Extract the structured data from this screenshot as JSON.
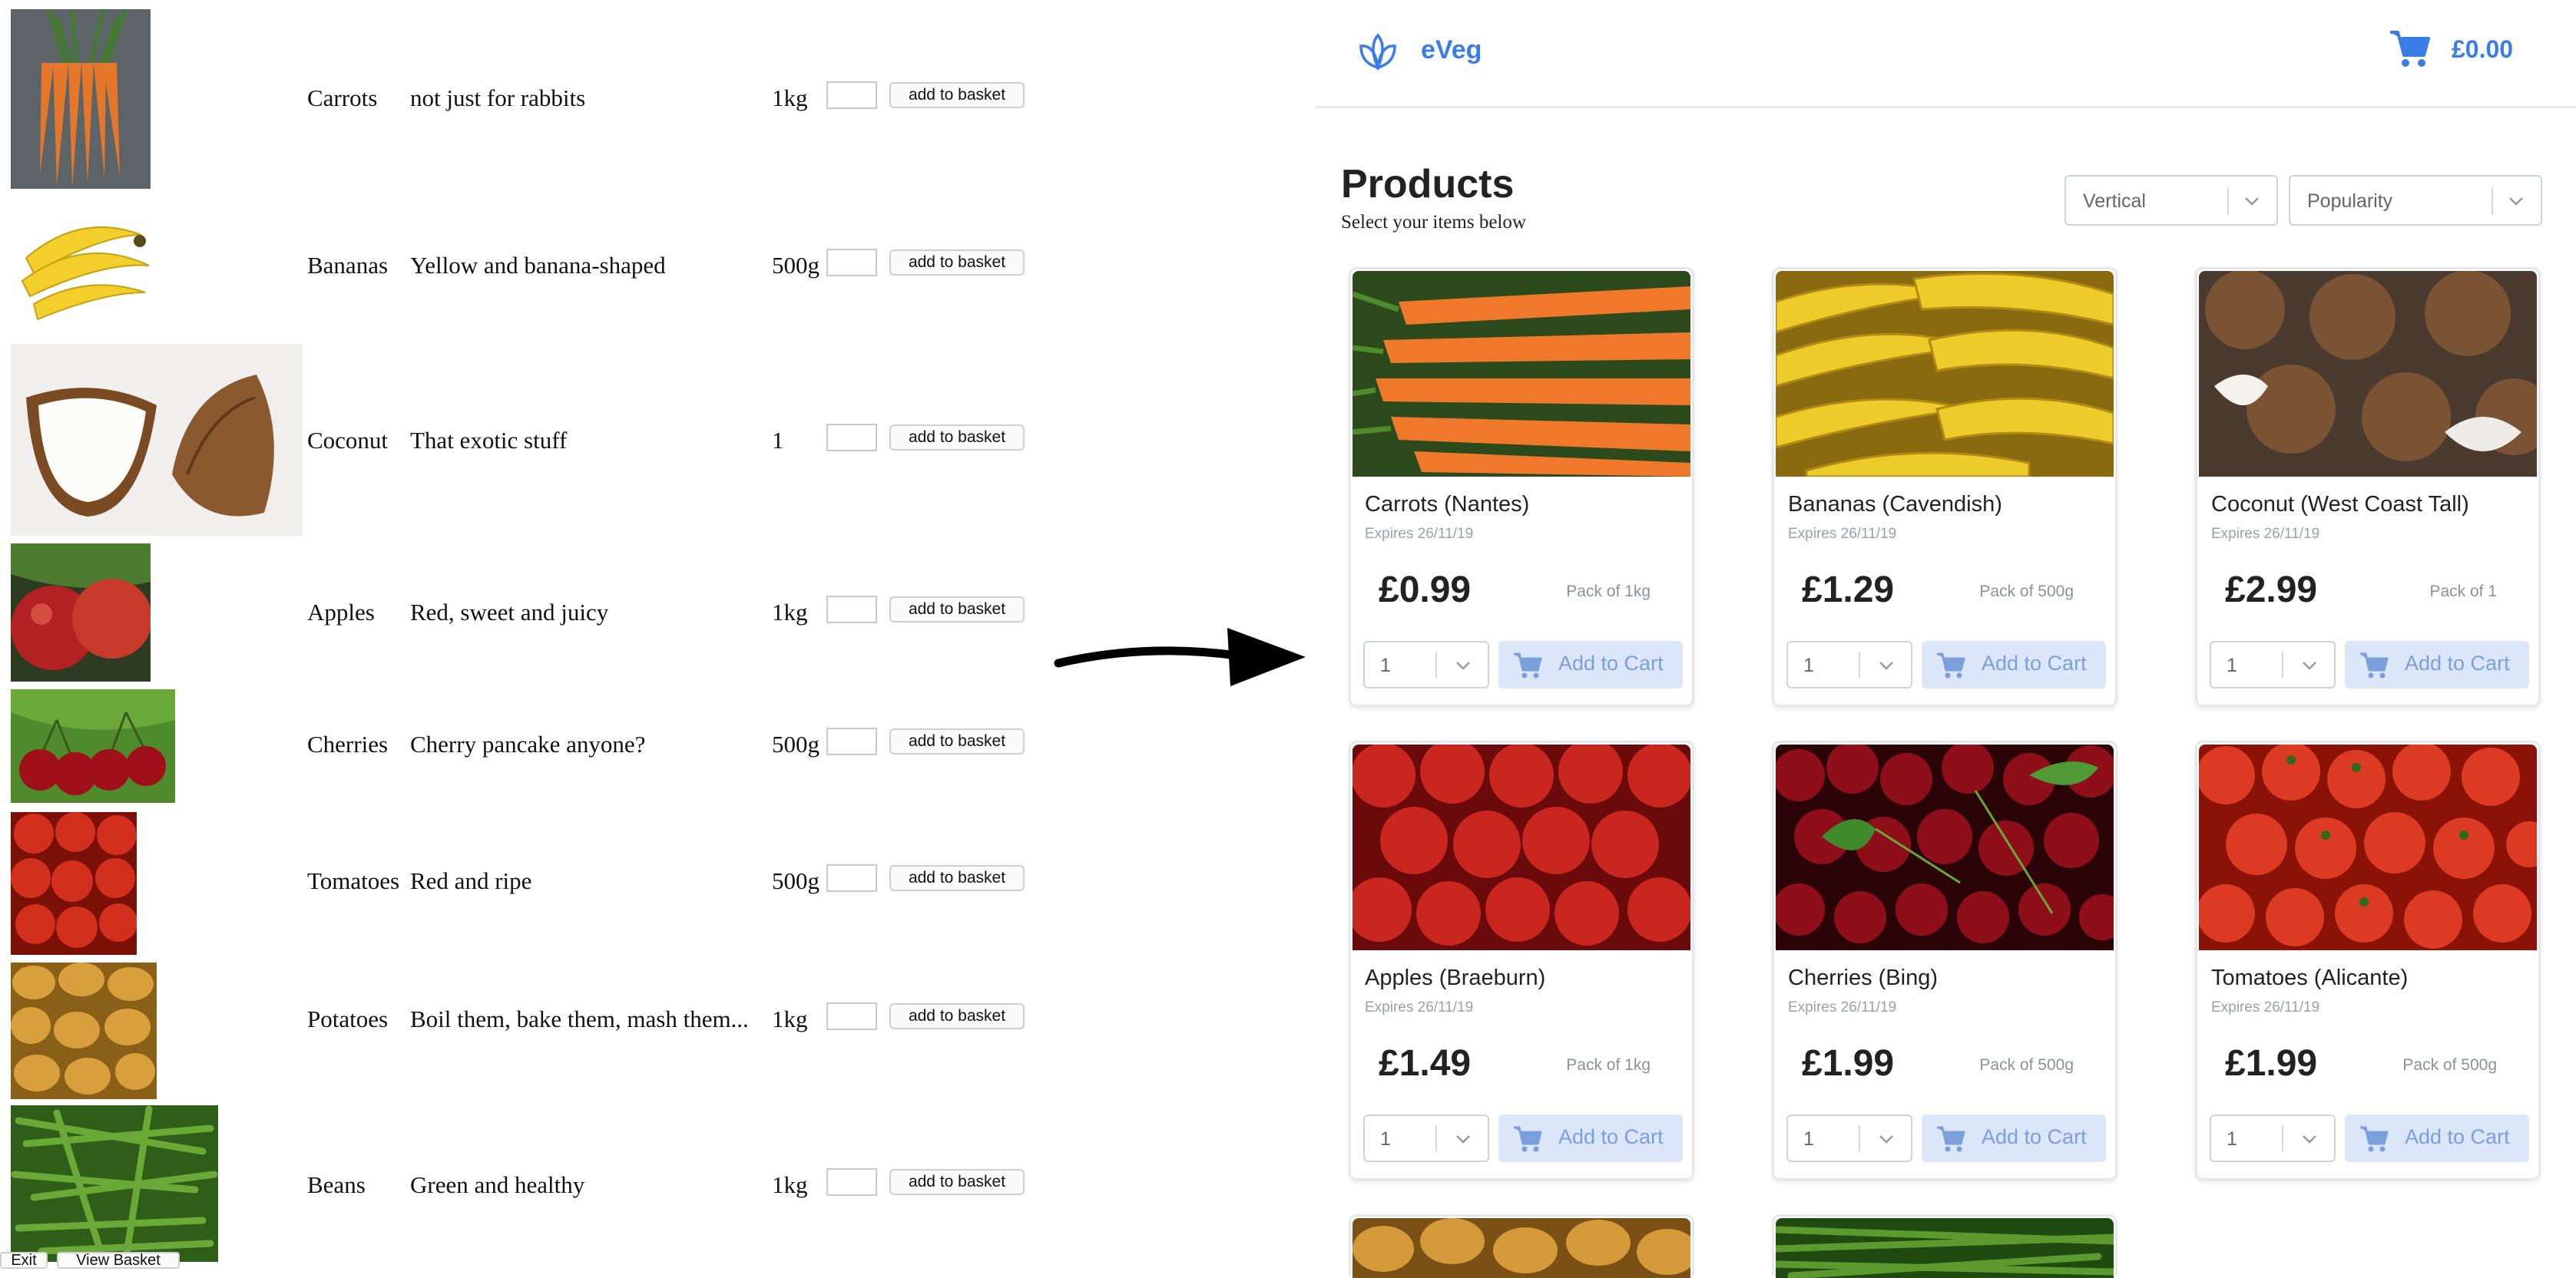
{
  "legacy": {
    "rows": [
      {
        "name": "Carrots",
        "desc": "not just for rabbits",
        "qty": "1kg",
        "button": "add to basket",
        "image": "carrots"
      },
      {
        "name": "Bananas",
        "desc": "Yellow and banana-shaped",
        "qty": "500g",
        "button": "add to basket",
        "image": "bananas"
      },
      {
        "name": "Coconut",
        "desc": "That exotic stuff",
        "qty": "1",
        "button": "add to basket",
        "image": "coconut"
      },
      {
        "name": "Apples",
        "desc": "Red, sweet and juicy",
        "qty": "1kg",
        "button": "add to basket",
        "image": "apples"
      },
      {
        "name": "Cherries",
        "desc": "Cherry pancake anyone?",
        "qty": "500g",
        "button": "add to basket",
        "image": "cherries"
      },
      {
        "name": "Tomatoes",
        "desc": "Red and ripe",
        "qty": "500g",
        "button": "add to basket",
        "image": "tomatoes"
      },
      {
        "name": "Potatoes",
        "desc": "Boil them, bake them, mash them...",
        "qty": "1kg",
        "button": "add to basket",
        "image": "potatoes"
      },
      {
        "name": "Beans",
        "desc": "Green and healthy",
        "qty": "1kg",
        "button": "add to basket",
        "image": "beans"
      }
    ],
    "footer": {
      "exit_label": "Exit",
      "view_basket_label": "View Basket"
    }
  },
  "app": {
    "brand": "eVeg",
    "cart_total": "£0.00",
    "title": "Products",
    "subtitle": "Select your items below",
    "layout_select": "Vertical",
    "sort_select": "Popularity",
    "add_label": "Add to Cart",
    "products": [
      {
        "name": "Carrots (Nantes)",
        "expires": "Expires 26/11/19",
        "price": "£0.99",
        "pack": "Pack of 1kg",
        "qty": "1",
        "image": "carrots"
      },
      {
        "name": "Bananas (Cavendish)",
        "expires": "Expires 26/11/19",
        "price": "£1.29",
        "pack": "Pack of 500g",
        "qty": "1",
        "image": "bananas"
      },
      {
        "name": "Coconut (West Coast Tall)",
        "expires": "Expires 26/11/19",
        "price": "£2.99",
        "pack": "Pack of 1",
        "qty": "1",
        "image": "coconut"
      },
      {
        "name": "Apples (Braeburn)",
        "expires": "Expires 26/11/19",
        "price": "£1.49",
        "pack": "Pack of 1kg",
        "qty": "1",
        "image": "apples"
      },
      {
        "name": "Cherries (Bing)",
        "expires": "Expires 26/11/19",
        "price": "£1.99",
        "pack": "Pack of 500g",
        "qty": "1",
        "image": "cherries"
      },
      {
        "name": "Tomatoes (Alicante)",
        "expires": "Expires 26/11/19",
        "price": "£1.99",
        "pack": "Pack of 500g",
        "qty": "1",
        "image": "tomatoes"
      }
    ],
    "partial_products": [
      {
        "image": "potatoes"
      },
      {
        "image": "beans"
      }
    ],
    "colors": {
      "accent": "#3b7de8",
      "button_bg": "#dbe7f8",
      "button_text": "#7b9fdc"
    }
  }
}
